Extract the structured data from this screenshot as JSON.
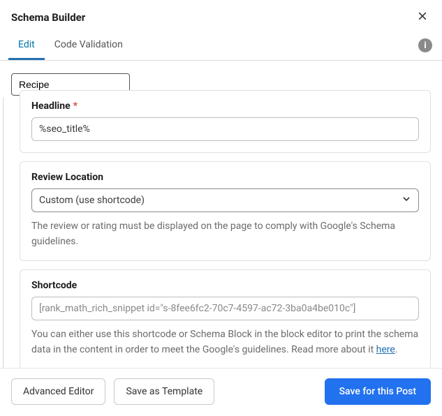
{
  "header": {
    "title": "Schema Builder"
  },
  "tabs": {
    "edit": "Edit",
    "validation": "Code Validation"
  },
  "schema_type": "Recipe",
  "fields": {
    "headline": {
      "label": "Headline",
      "value": "%seo_title%"
    },
    "review_location": {
      "label": "Review Location",
      "selected": "Custom (use shortcode)",
      "helper": "The review or rating must be displayed on the page to comply with Google's Schema guidelines."
    },
    "shortcode": {
      "label": "Shortcode",
      "value": "[rank_math_rich_snippet id=\"s-8fee6fc2-70c7-4597-ac72-3ba0a4be010c\"]",
      "helper_before": "You can either use this shortcode or Schema Block in the block editor to print the schema data in the content in order to meet the Google's guidelines. Read more about it ",
      "helper_link": "here",
      "helper_after": "."
    }
  },
  "footer": {
    "advanced": "Advanced Editor",
    "save_template": "Save as Template",
    "save_post": "Save for this Post"
  }
}
